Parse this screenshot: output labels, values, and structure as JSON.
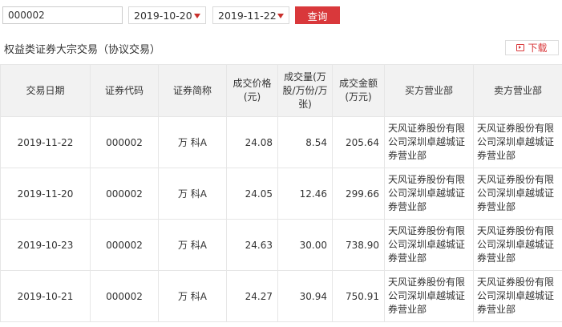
{
  "filter": {
    "code_value": "000002",
    "start_date": "2019-10-20",
    "end_date": "2019-11-22",
    "query_label": "查询"
  },
  "section": {
    "title": "权益类证券大宗交易（协议交易）",
    "download_label": "下载"
  },
  "table": {
    "headers": {
      "date": "交易日期",
      "code": "证券代码",
      "name": "证券简称",
      "price": "成交价格(元)",
      "volume": "成交量(万股/万份/万张)",
      "amount": "成交金额(万元)",
      "buyer": "买方营业部",
      "seller": "卖方营业部"
    },
    "rows": [
      {
        "date": "2019-11-22",
        "code": "000002",
        "name": "万 科A",
        "price": "24.08",
        "volume": "8.54",
        "amount": "205.64",
        "buyer": "天风证券股份有限公司深圳卓越城证券营业部",
        "seller": "天风证券股份有限公司深圳卓越城证券营业部"
      },
      {
        "date": "2019-11-20",
        "code": "000002",
        "name": "万 科A",
        "price": "24.05",
        "volume": "12.46",
        "amount": "299.66",
        "buyer": "天风证券股份有限公司深圳卓越城证券营业部",
        "seller": "天风证券股份有限公司深圳卓越城证券营业部"
      },
      {
        "date": "2019-10-23",
        "code": "000002",
        "name": "万 科A",
        "price": "24.63",
        "volume": "30.00",
        "amount": "738.90",
        "buyer": "天风证券股份有限公司深圳卓越城证券营业部",
        "seller": "天风证券股份有限公司深圳卓越城证券营业部"
      },
      {
        "date": "2019-10-21",
        "code": "000002",
        "name": "万 科A",
        "price": "24.27",
        "volume": "30.94",
        "amount": "750.91",
        "buyer": "天风证券股份有限公司深圳卓越城证券营业部",
        "seller": "天风证券股份有限公司深圳卓越城证券营业部"
      }
    ]
  },
  "colors": {
    "accent": "#d9383b",
    "header_bg": "#f2f2f2",
    "border": "#e6e6e6"
  }
}
